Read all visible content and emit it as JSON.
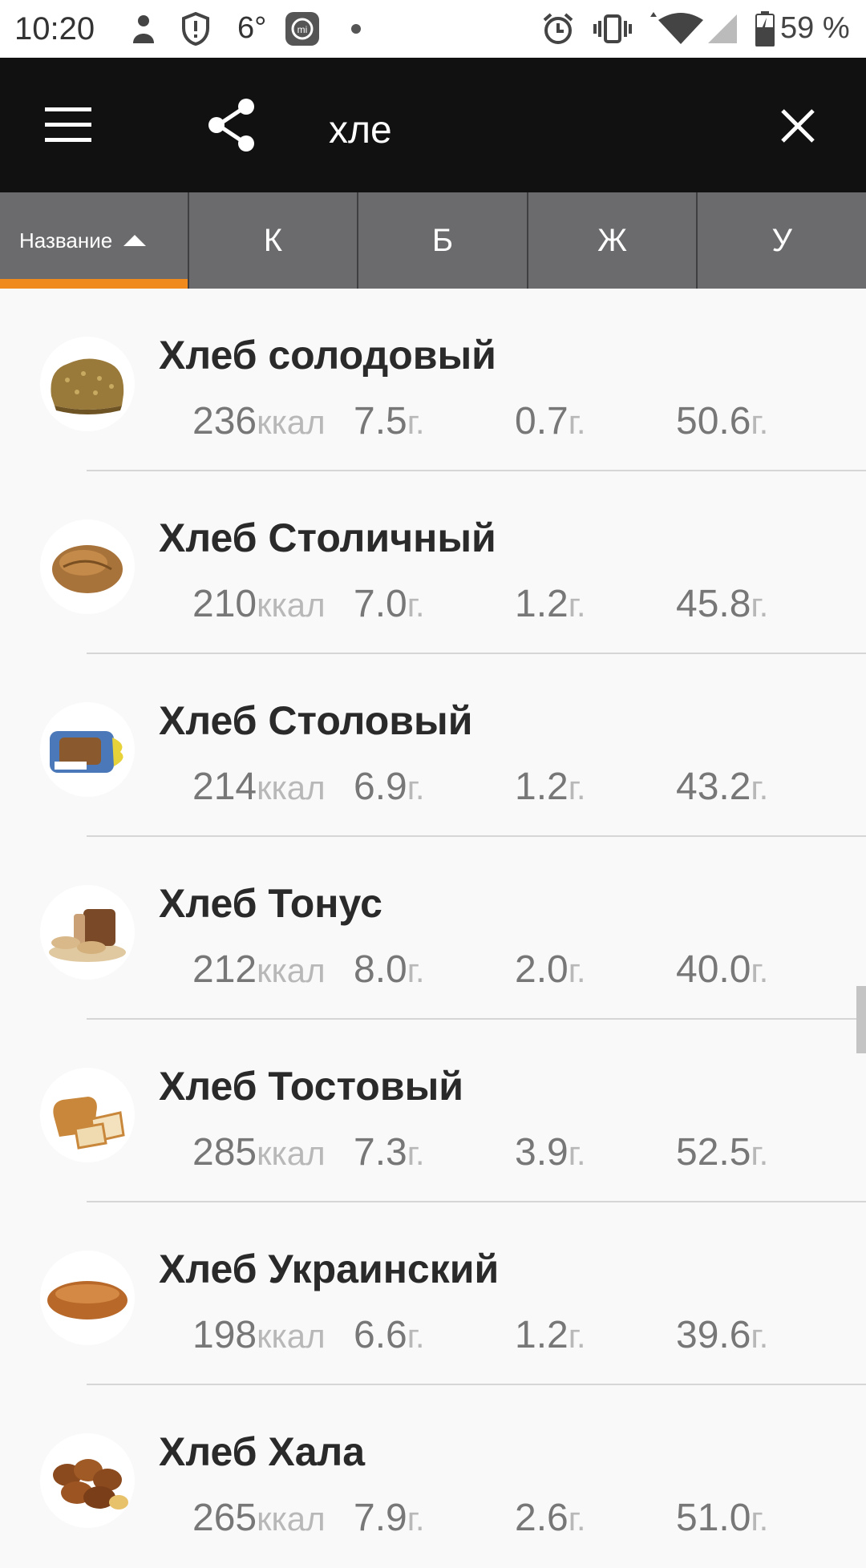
{
  "status_bar": {
    "time": "10:20",
    "temperature": "6°",
    "battery": "59 %"
  },
  "app_bar": {
    "search_value": "хле"
  },
  "columns": {
    "name": "Название",
    "kcal": "К",
    "protein": "Б",
    "fat": "Ж",
    "carbs": "У"
  },
  "units": {
    "kcal": "ккал",
    "gram": "г."
  },
  "products": [
    {
      "name": "Хлеб солодовый",
      "kcal": "236",
      "protein": "7.5",
      "fat": "0.7",
      "carbs": "50.6"
    },
    {
      "name": "Хлеб Столичный",
      "kcal": "210",
      "protein": "7.0",
      "fat": "1.2",
      "carbs": "45.8"
    },
    {
      "name": "Хлеб Столовый",
      "kcal": "214",
      "protein": "6.9",
      "fat": "1.2",
      "carbs": "43.2"
    },
    {
      "name": "Хлеб Тонус",
      "kcal": "212",
      "protein": "8.0",
      "fat": "2.0",
      "carbs": "40.0"
    },
    {
      "name": "Хлеб Тостовый",
      "kcal": "285",
      "protein": "7.3",
      "fat": "3.9",
      "carbs": "52.5"
    },
    {
      "name": "Хлеб Украинский",
      "kcal": "198",
      "protein": "6.6",
      "fat": "1.2",
      "carbs": "39.6"
    },
    {
      "name": "Хлеб Хала",
      "kcal": "265",
      "protein": "7.9",
      "fat": "2.6",
      "carbs": "51.0"
    }
  ],
  "colors": {
    "accent": "#f08a1c",
    "app_bar": "#111111",
    "header": "#6b6b6d"
  }
}
